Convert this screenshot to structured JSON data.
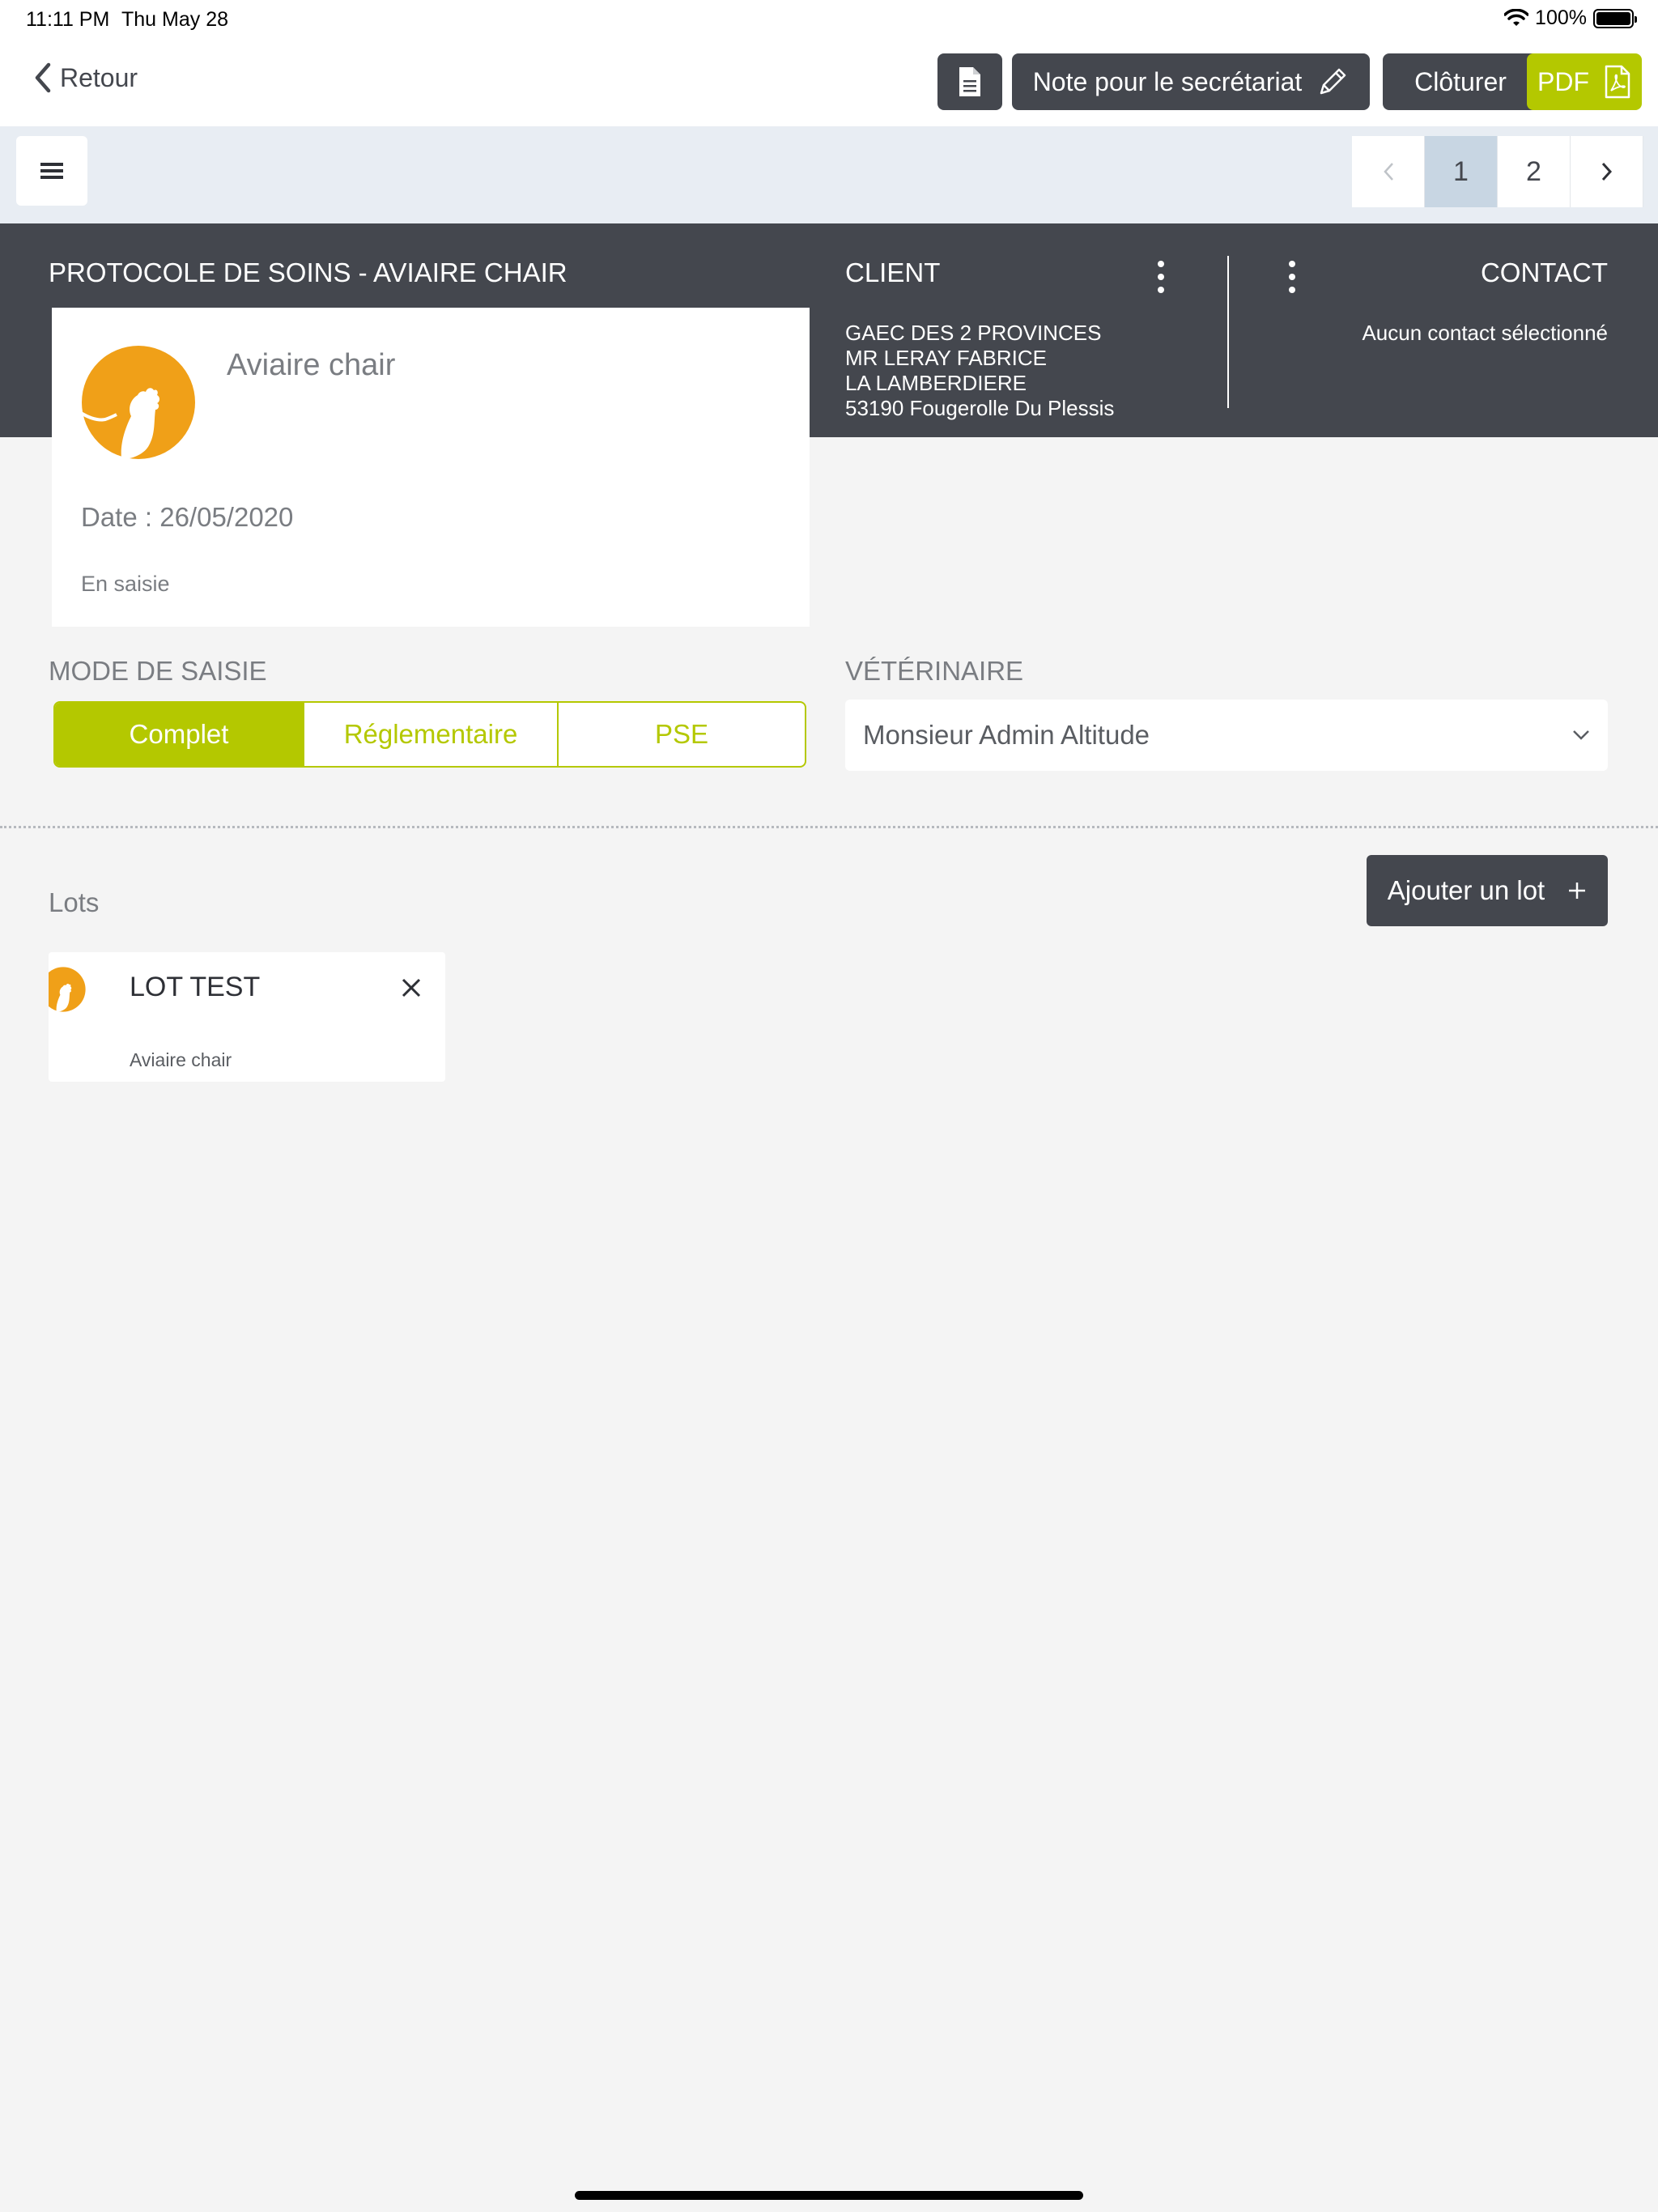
{
  "status_bar": {
    "time": "11:11 PM",
    "date": "Thu May 28",
    "battery": "100%"
  },
  "nav": {
    "back_label": "Retour",
    "note_label": "Note pour le secrétariat",
    "close_label": "Clôturer",
    "pdf_label": "PDF"
  },
  "pager": {
    "pages": [
      "1",
      "2"
    ],
    "current": "1"
  },
  "header": {
    "title": "PROTOCOLE DE SOINS - AVIAIRE CHAIR",
    "client_title": "CLIENT",
    "client_address": [
      "GAEC DES 2 PROVINCES",
      "MR LERAY FABRICE",
      "LA LAMBERDIERE",
      "53190 Fougerolle Du Plessis"
    ],
    "contact_title": "CONTACT",
    "contact_value": "Aucun contact sélectionné"
  },
  "card": {
    "species": "Aviaire chair",
    "date": "Date : 26/05/2020",
    "status": "En saisie"
  },
  "mode": {
    "label": "MODE DE SAISIE",
    "options": [
      "Complet",
      "Réglementaire",
      "PSE"
    ],
    "selected": "Complet"
  },
  "vet": {
    "label": "VÉTÉRINAIRE",
    "selected": "Monsieur Admin Altitude"
  },
  "lots": {
    "label": "Lots",
    "add_label": "Ajouter un lot",
    "items": [
      {
        "name": "LOT TEST",
        "species": "Aviaire chair"
      }
    ]
  },
  "colors": {
    "accent": "#b4c800",
    "dark": "#44474e",
    "icon_orange": "#f0a018"
  }
}
